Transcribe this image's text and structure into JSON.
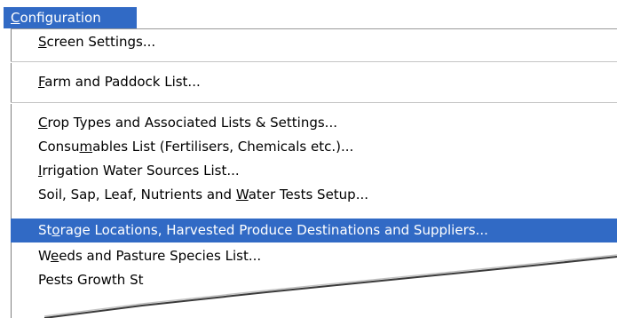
{
  "menu": {
    "title": {
      "pre": "",
      "ul": "C",
      "post": "onfiguration"
    },
    "items": [
      {
        "pre": "",
        "ul": "S",
        "post": "creen Settings..."
      },
      {
        "pre": "",
        "ul": "F",
        "post": "arm and Paddock List..."
      },
      {
        "pre": "",
        "ul": "C",
        "post": "rop Types and Associated Lists & Settings..."
      },
      {
        "pre": "Consu",
        "ul": "m",
        "post": "ables List (Fertilisers, Chemicals etc.)..."
      },
      {
        "pre": "",
        "ul": "I",
        "post": "rrigation Water Sources List..."
      },
      {
        "pre": "Soil, Sap, Leaf, Nutrients and ",
        "ul": "W",
        "post": "ater Tests Setup..."
      },
      {
        "pre": "St",
        "ul": "o",
        "post": "rage Locations, Harvested Produce Destinations and Suppliers..."
      },
      {
        "pre": "W",
        "ul": "e",
        "post": "eds and Pasture Species List..."
      },
      {
        "pre": "Pests Growth St",
        "ul": "",
        "post": ""
      }
    ]
  },
  "colors": {
    "highlight": "#316ac5",
    "highlight_text": "#ffffff",
    "separator": "#c4c4c4"
  }
}
